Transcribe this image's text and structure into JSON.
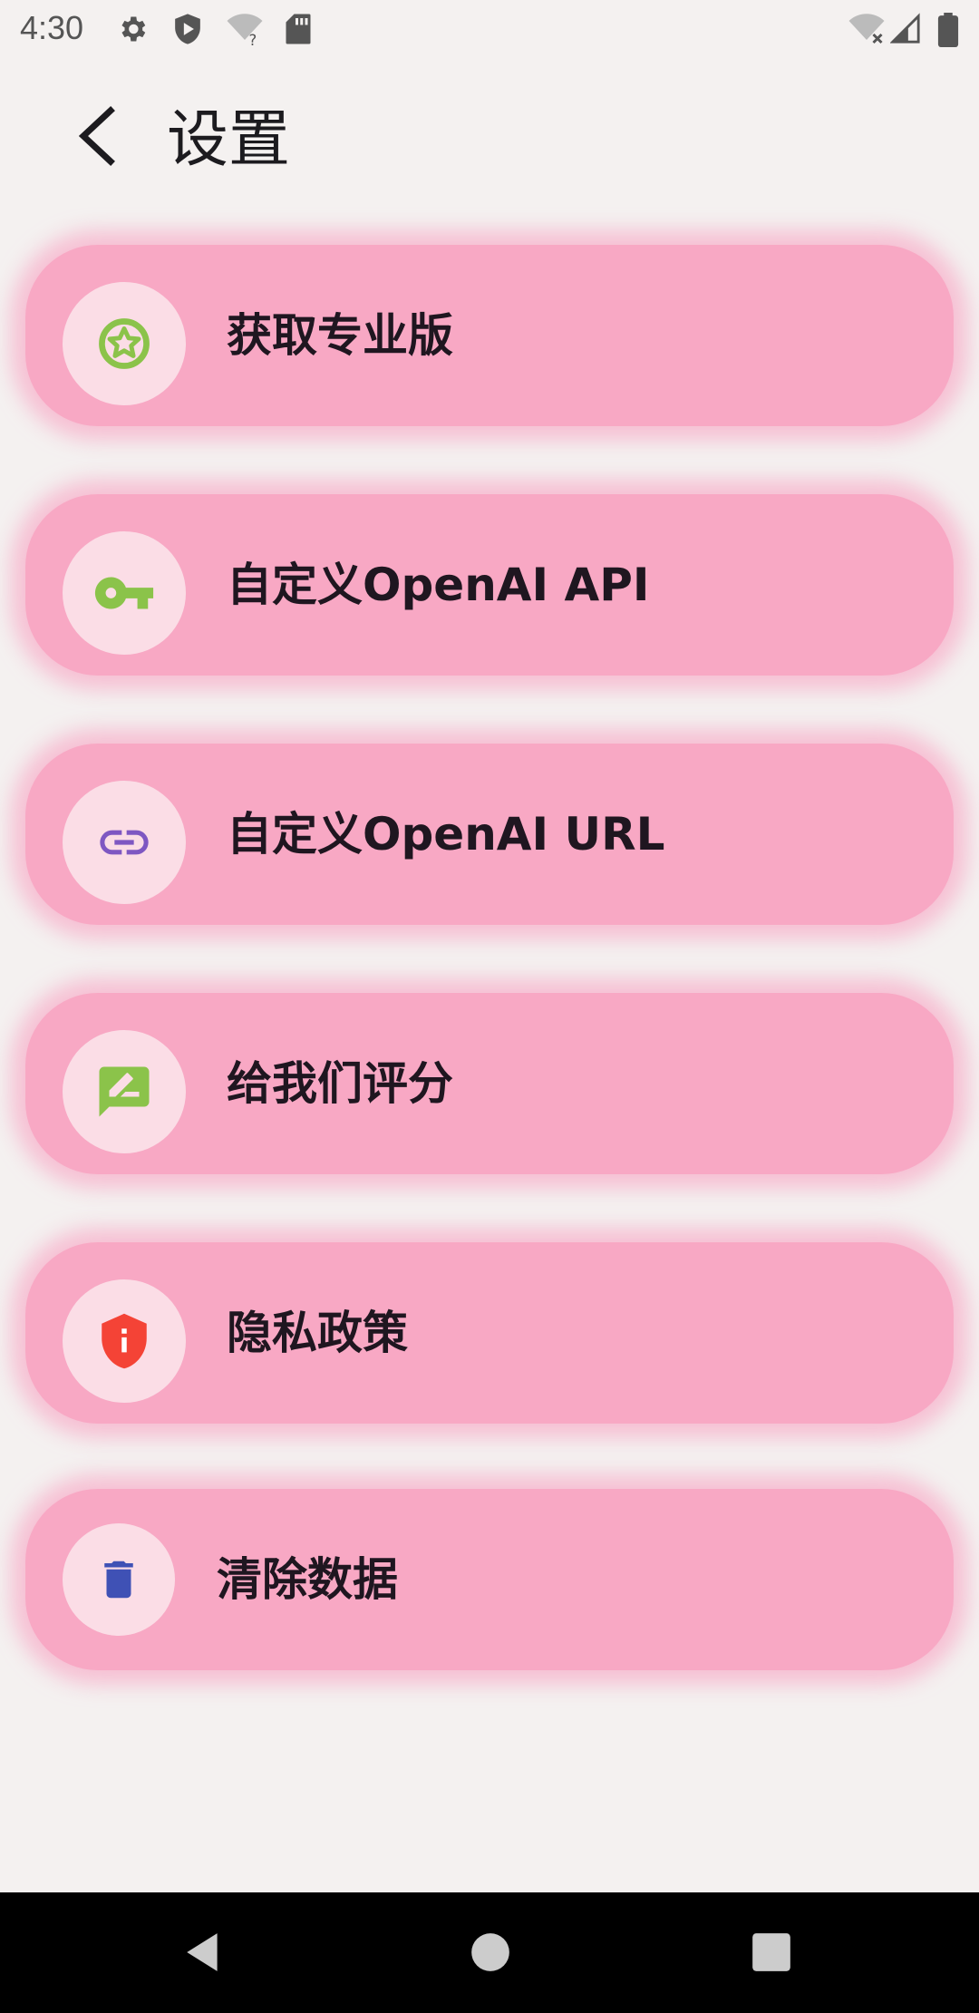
{
  "status_bar": {
    "time": "4:30",
    "icons_left": [
      "gear-icon",
      "play-protect-icon",
      "wifi-question-icon",
      "sd-card-icon"
    ],
    "icons_right": [
      "wifi-off-icon",
      "signal-icon",
      "battery-icon"
    ]
  },
  "header": {
    "title": "设置",
    "back_icon": "chevron-left-icon"
  },
  "menu": {
    "items": [
      {
        "label": "获取专业版",
        "icon": "star-circle-icon",
        "icon_color": "#8bc34a"
      },
      {
        "label": "自定义OpenAI API",
        "icon": "key-icon",
        "icon_color": "#8bc34a"
      },
      {
        "label": "自定义OpenAI URL",
        "icon": "link-icon",
        "icon_color": "#7e57c2"
      },
      {
        "label": "给我们评分",
        "icon": "rate-review-icon",
        "icon_color": "#8bc34a"
      },
      {
        "label": "隐私政策",
        "icon": "shield-info-icon",
        "icon_color": "#f44336"
      },
      {
        "label": "清除数据",
        "icon": "trash-icon",
        "icon_color": "#3f51b5"
      }
    ],
    "item_color": "#f8a8c4",
    "icon_bg_color": "#fbdde6"
  },
  "nav_bar": {
    "buttons": [
      "back-triangle-icon",
      "home-circle-icon",
      "recents-square-icon"
    ]
  }
}
